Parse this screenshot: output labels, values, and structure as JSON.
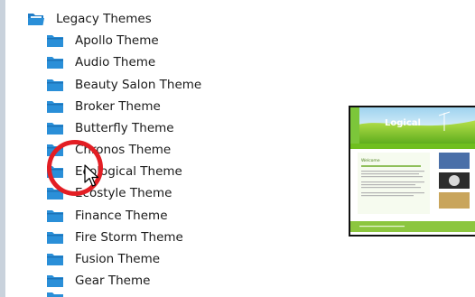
{
  "tree": {
    "root": {
      "label": "Legacy Themes",
      "icon": "open-folder-icon"
    },
    "items": [
      {
        "label": "Apollo Theme",
        "icon": "folder-icon"
      },
      {
        "label": "Audio Theme",
        "icon": "folder-icon"
      },
      {
        "label": "Beauty Salon Theme",
        "icon": "folder-icon"
      },
      {
        "label": "Broker Theme",
        "icon": "folder-icon"
      },
      {
        "label": "Butterfly Theme",
        "icon": "folder-icon"
      },
      {
        "label": "Chronos Theme",
        "icon": "folder-icon"
      },
      {
        "label": "Ecological Theme",
        "icon": "folder-icon"
      },
      {
        "label": "Ecostyle Theme",
        "icon": "folder-icon"
      },
      {
        "label": "Finance Theme",
        "icon": "folder-icon"
      },
      {
        "label": "Fire Storm Theme",
        "icon": "folder-icon"
      },
      {
        "label": "Fusion Theme",
        "icon": "folder-icon"
      },
      {
        "label": "Gear Theme",
        "icon": "folder-icon"
      }
    ]
  },
  "preview": {
    "logo_text": "Logical",
    "heading": "Welcome",
    "colors": {
      "green": "#6fbf1f",
      "sky": "#bfe3f6",
      "footer": "#8cc63f"
    }
  },
  "colors": {
    "folder": "#2a8fd8",
    "highlight_ring": "#e31e24"
  }
}
